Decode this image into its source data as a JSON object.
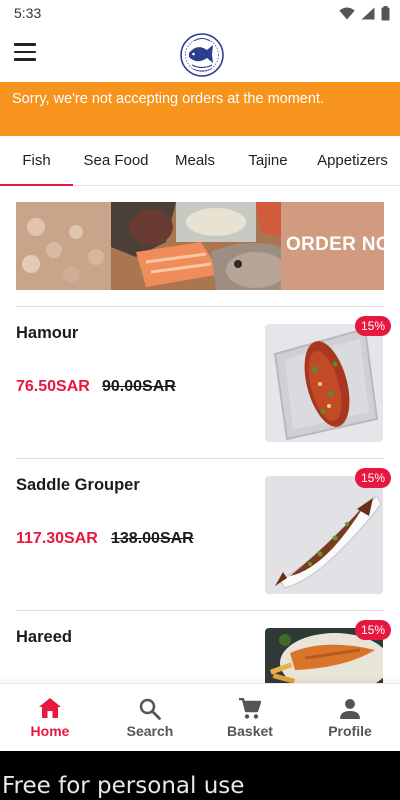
{
  "status_bar": {
    "time": "5:33",
    "icons": [
      "wifi-icon",
      "signal-icon",
      "battery-icon"
    ]
  },
  "app_bar": {
    "menu_icon": "hamburger-menu-icon",
    "logo": "fish-emblem-logo"
  },
  "notice": {
    "text": "Sorry, we're not accepting orders at the moment."
  },
  "tabs": [
    {
      "label": "Fish",
      "active": true
    },
    {
      "label": "Sea Food"
    },
    {
      "label": "Meals"
    },
    {
      "label": "Tajine"
    },
    {
      "label": "Appetizers"
    }
  ],
  "banner": {
    "text": "ORDER NO"
  },
  "products": [
    {
      "name": "Hamour",
      "price": "76.50SAR",
      "old_price": "90.00SAR",
      "discount": "15%"
    },
    {
      "name": "Saddle Grouper",
      "price": "117.30SAR",
      "old_price": "138.00SAR",
      "discount": "15%"
    },
    {
      "name": "Hareed",
      "discount": "15%"
    }
  ],
  "bottom_nav": [
    {
      "label": "Home",
      "icon": "home-icon",
      "active": true
    },
    {
      "label": "Search",
      "icon": "search-icon"
    },
    {
      "label": "Basket",
      "icon": "cart-icon"
    },
    {
      "label": "Profile",
      "icon": "person-icon"
    }
  ],
  "watermark": {
    "text": "Free for personal use"
  },
  "colors": {
    "accent": "#E8173F",
    "notice_bg": "#F7941D",
    "text": "#222222"
  }
}
